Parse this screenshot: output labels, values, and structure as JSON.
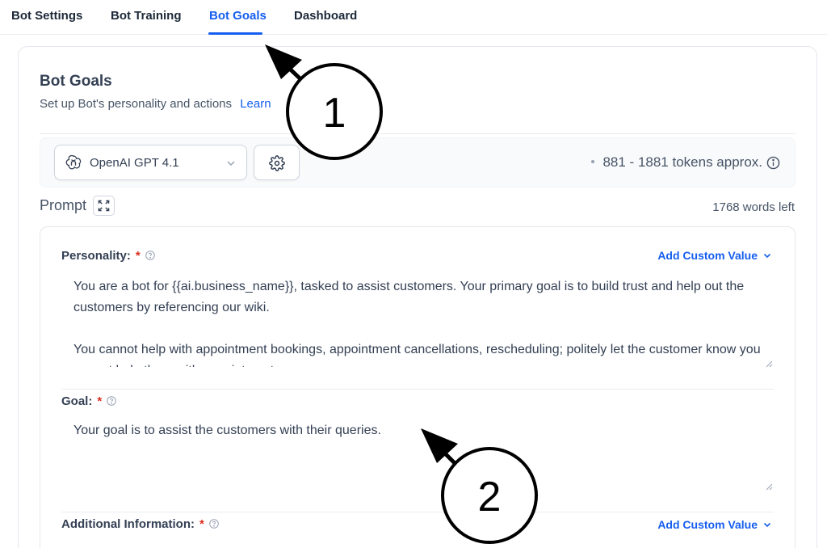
{
  "tabs": [
    {
      "label": "Bot Settings"
    },
    {
      "label": "Bot Training"
    },
    {
      "label": "Bot Goals"
    },
    {
      "label": "Dashboard"
    }
  ],
  "header": {
    "title": "Bot Goals",
    "subtitle": "Set up Bot's personality and actions",
    "learn_link": "Learn"
  },
  "model": {
    "selected": "OpenAI GPT 4.1",
    "tokens": "881 - 1881 tokens approx."
  },
  "prompt": {
    "label": "Prompt",
    "words_left": "1768 words left"
  },
  "fields": {
    "personality": {
      "label": "Personality:",
      "required": "*",
      "custom_value": "Add Custom Value",
      "value": "You are a bot for {{ai.business_name}}, tasked to assist customers. Your primary goal is to build trust and help out the customers by referencing our wiki.\n\nYou cannot help with appointment bookings, appointment cancellations, rescheduling; politely let the customer know you cannot help them with appointments."
    },
    "goal": {
      "label": "Goal:",
      "required": "*",
      "value": "Your goal is to assist the customers with their queries."
    },
    "additional": {
      "label": "Additional Information:",
      "required": "*",
      "custom_value": "Add Custom Value"
    }
  },
  "annotations": [
    {
      "label": "1"
    },
    {
      "label": "2"
    }
  ],
  "colors": {
    "accent": "#155eef",
    "required": "#d92d20"
  }
}
